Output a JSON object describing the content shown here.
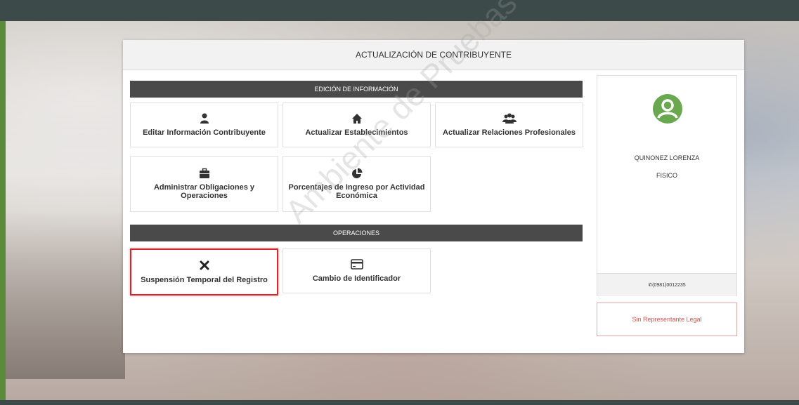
{
  "header": {
    "title": "ACTUALIZACIÓN DE CONTRIBUYENTE"
  },
  "sections": {
    "edicion": "EDICIÓN DE INFORMACIÓN",
    "operaciones": "OPERACIONES"
  },
  "tiles": {
    "editar": {
      "label": "Editar Información Contribuyente",
      "icon": "user-icon"
    },
    "establecimientos": {
      "label": "Actualizar Establecimientos",
      "icon": "home-icon"
    },
    "relaciones": {
      "label": "Actualizar Relaciones Profesionales",
      "icon": "users-icon"
    },
    "obligaciones": {
      "label": "Administrar Obligaciones y Operaciones",
      "icon": "briefcase-icon"
    },
    "porcentajes": {
      "label": "Porcentajes de Ingreso por Actividad Económica",
      "icon": "pie-chart-icon"
    },
    "suspension": {
      "label": "Suspensión Temporal del Registro",
      "icon": "close-icon"
    },
    "cambio": {
      "label": "Cambio de Identificador",
      "icon": "credit-card-icon"
    }
  },
  "profile": {
    "name": "QUINONEZ LORENZA",
    "type": "FISICO",
    "phone": "✆(0981)0012235",
    "avatar_color": "#6aa84f"
  },
  "representative": {
    "label": "Sin Representante Legal"
  },
  "watermark": "Ambiente de Pruebas",
  "colors": {
    "accent_red": "#d9262a",
    "section_bar": "#4a4a4a"
  }
}
